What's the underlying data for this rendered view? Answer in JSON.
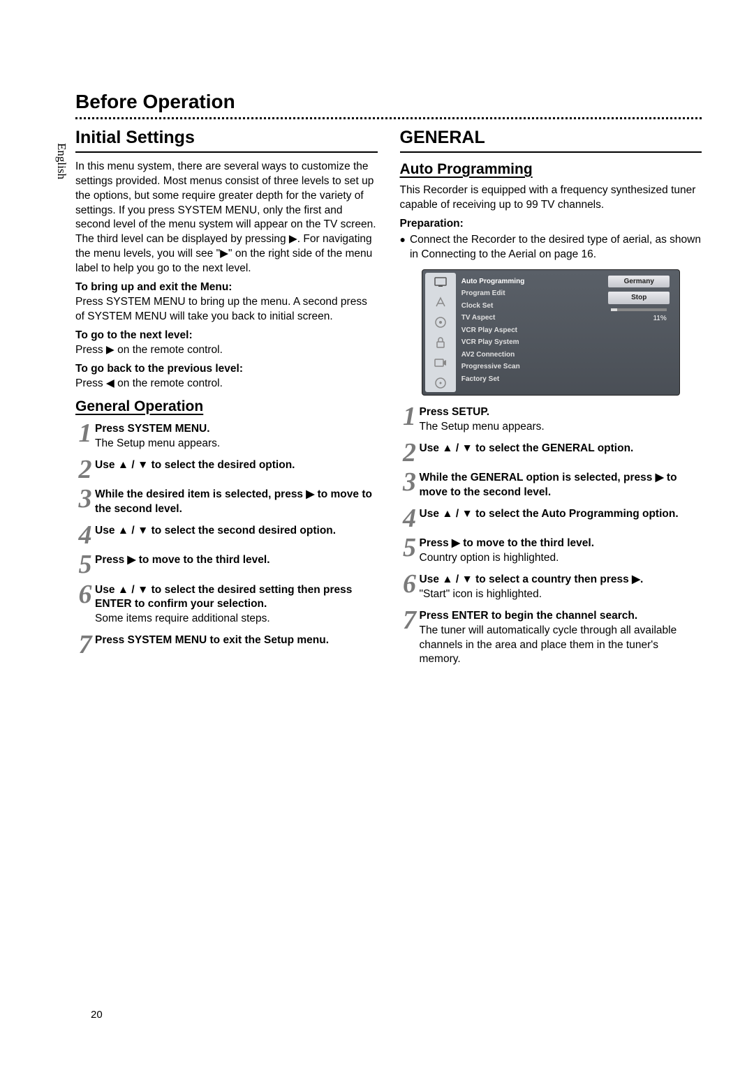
{
  "langTab": "English",
  "beforeOperation": "Before Operation",
  "leftCol": {
    "initialSettings": "Initial Settings",
    "intro": "In this menu system, there are several ways to customize the settings provided. Most menus consist of three levels to set up the options, but some require greater depth for the variety of settings. If you press SYSTEM MENU, only the first and second level of the menu system will appear on the TV screen. The third level can be displayed by pressing ▶. For navigating the menu levels, you will see \"▶\" on the right side of the menu label to help you go to the next level.",
    "bringUpTitle": "To bring up and exit the Menu:",
    "bringUpBody": "Press SYSTEM MENU to bring up the menu. A second press of SYSTEM MENU will take you back to initial screen.",
    "nextLevelTitle": "To go to the next level:",
    "nextLevelBody": "Press ▶ on the remote control.",
    "prevLevelTitle": "To go back to the previous level:",
    "prevLevelBody": "Press ◀ on the remote control.",
    "generalOperation": "General Operation",
    "steps": [
      {
        "n": "1",
        "bold": "Press SYSTEM MENU.",
        "body": "The Setup menu appears."
      },
      {
        "n": "2",
        "bold": "Use ▲ / ▼ to select the desired option.",
        "body": ""
      },
      {
        "n": "3",
        "bold": "While the desired item is selected, press ▶ to move to the second level.",
        "body": ""
      },
      {
        "n": "4",
        "bold": "Use ▲ / ▼ to select the second desired option.",
        "body": ""
      },
      {
        "n": "5",
        "bold": "Press ▶ to move to the third level.",
        "body": ""
      },
      {
        "n": "6",
        "bold": "Use ▲ / ▼ to select the desired setting then press ENTER to confirm your selection.",
        "body": "Some items require additional steps."
      },
      {
        "n": "7",
        "bold": "Press SYSTEM MENU to exit the Setup menu.",
        "body": ""
      }
    ]
  },
  "rightCol": {
    "general": "GENERAL",
    "autoProgramming": "Auto Programming",
    "intro": "This Recorder is equipped with a frequency synthesized tuner capable of receiving up to 99 TV channels.",
    "prepTitle": "Preparation:",
    "prepBullet": "Connect the Recorder to the desired type of aerial, as shown in Connecting to the Aerial on page 16.",
    "osd": {
      "items": [
        "Auto Programming",
        "Program Edit",
        "Clock Set",
        "TV Aspect",
        "VCR Play Aspect",
        "VCR Play System",
        "AV2 Connection",
        "Progressive Scan",
        "Factory Set"
      ],
      "country": "Germany",
      "stop": "Stop",
      "pct": "11%"
    },
    "steps": [
      {
        "n": "1",
        "bold": "Press SETUP.",
        "body": "The Setup menu appears."
      },
      {
        "n": "2",
        "bold": "Use ▲ / ▼ to select the GENERAL option.",
        "body": ""
      },
      {
        "n": "3",
        "bold": "While the GENERAL option is selected, press ▶ to move to the second level.",
        "body": ""
      },
      {
        "n": "4",
        "bold": "Use ▲ / ▼ to select the Auto Programming option.",
        "body": ""
      },
      {
        "n": "5",
        "bold": "Press ▶ to move to the third level.",
        "body": "Country option is highlighted."
      },
      {
        "n": "6",
        "bold": "Use ▲ / ▼ to select a country then press ▶.",
        "body": "\"Start\" icon is highlighted."
      },
      {
        "n": "7",
        "bold": "Press ENTER to begin the channel search.",
        "body": "The tuner will automatically cycle through all available channels in the area and place them in the tuner's memory."
      }
    ]
  },
  "pageNum": "20"
}
